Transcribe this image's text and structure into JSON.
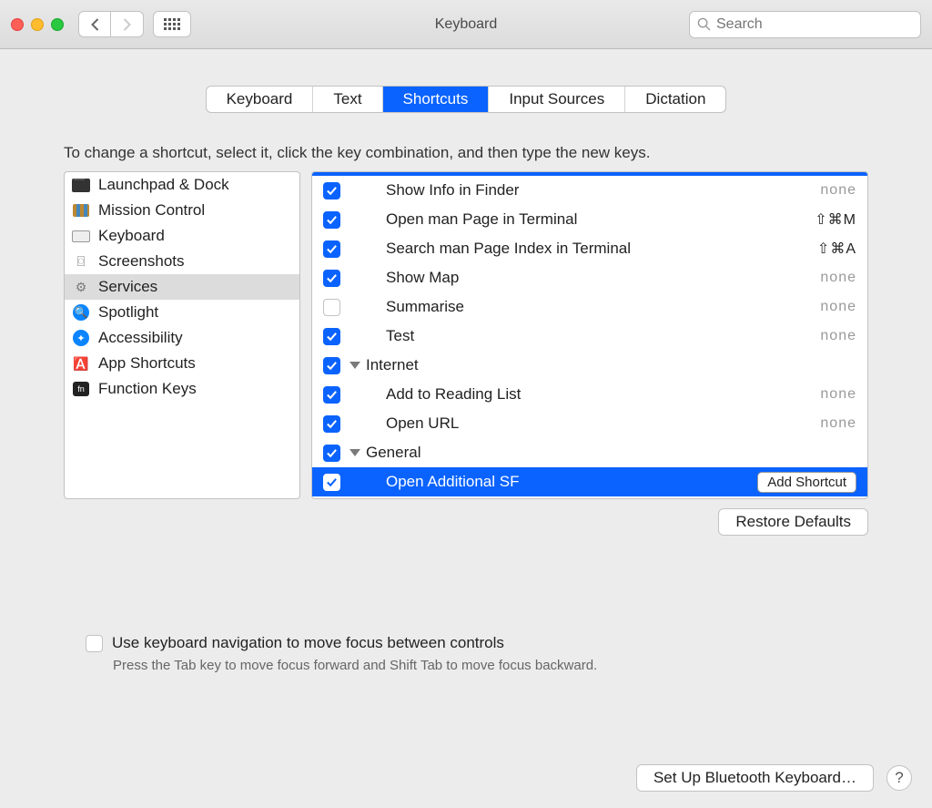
{
  "window": {
    "title": "Keyboard"
  },
  "search": {
    "placeholder": "Search"
  },
  "tabs": {
    "keyboard": "Keyboard",
    "text": "Text",
    "shortcuts": "Shortcuts",
    "input_sources": "Input Sources",
    "dictation": "Dictation"
  },
  "instruction": "To change a shortcut, select it, click the key combination, and then type the new keys.",
  "sidebar": {
    "items": [
      "Launchpad & Dock",
      "Mission Control",
      "Keyboard",
      "Screenshots",
      "Services",
      "Spotlight",
      "Accessibility",
      "App Shortcuts",
      "Function Keys"
    ]
  },
  "detail": {
    "rows": [
      {
        "label": "Show Info in Finder",
        "shortcut": "none"
      },
      {
        "label": "Open man Page in Terminal",
        "shortcut": "⇧⌘M"
      },
      {
        "label": "Search man Page Index in Terminal",
        "shortcut": "⇧⌘A"
      },
      {
        "label": "Show Map",
        "shortcut": "none"
      },
      {
        "label": "Summarise",
        "shortcut": "none"
      },
      {
        "label": "Test",
        "shortcut": "none"
      },
      {
        "label": "Internet"
      },
      {
        "label": "Add to Reading List",
        "shortcut": "none"
      },
      {
        "label": "Open URL",
        "shortcut": "none"
      },
      {
        "label": "General"
      },
      {
        "label": "Open Additional SF",
        "button": "Add Shortcut"
      }
    ]
  },
  "buttons": {
    "restore": "Restore Defaults",
    "bluetooth": "Set Up Bluetooth Keyboard…",
    "add_shortcut": "Add Shortcut"
  },
  "footer": {
    "checkbox_label": "Use keyboard navigation to move focus between controls",
    "hint": "Press the Tab key to move focus forward and Shift Tab to move focus backward."
  },
  "help": "?"
}
